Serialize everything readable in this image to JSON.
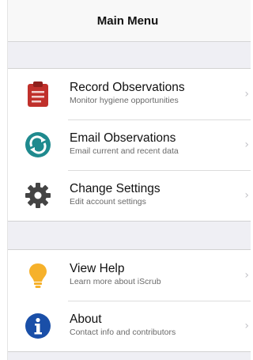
{
  "navbar": {
    "title": "Main Menu"
  },
  "menu": {
    "record": {
      "title": "Record Observations",
      "subtitle": "Monitor hygiene opportunities",
      "icon": "clipboard-icon",
      "color": "#c0302b"
    },
    "email": {
      "title": "Email Observations",
      "subtitle": "Email current and recent data",
      "icon": "sync-icon",
      "color": "#1f8a8e"
    },
    "settings": {
      "title": "Change Settings",
      "subtitle": "Edit account settings",
      "icon": "gear-icon",
      "color": "#444444"
    },
    "help": {
      "title": "View Help",
      "subtitle": "Learn more about iScrub",
      "icon": "lightbulb-icon",
      "color": "#f6b12b"
    },
    "about": {
      "title": "About",
      "subtitle": "Contact info and contributors",
      "icon": "info-icon",
      "color": "#1a4fa8"
    }
  },
  "chevron": "›"
}
